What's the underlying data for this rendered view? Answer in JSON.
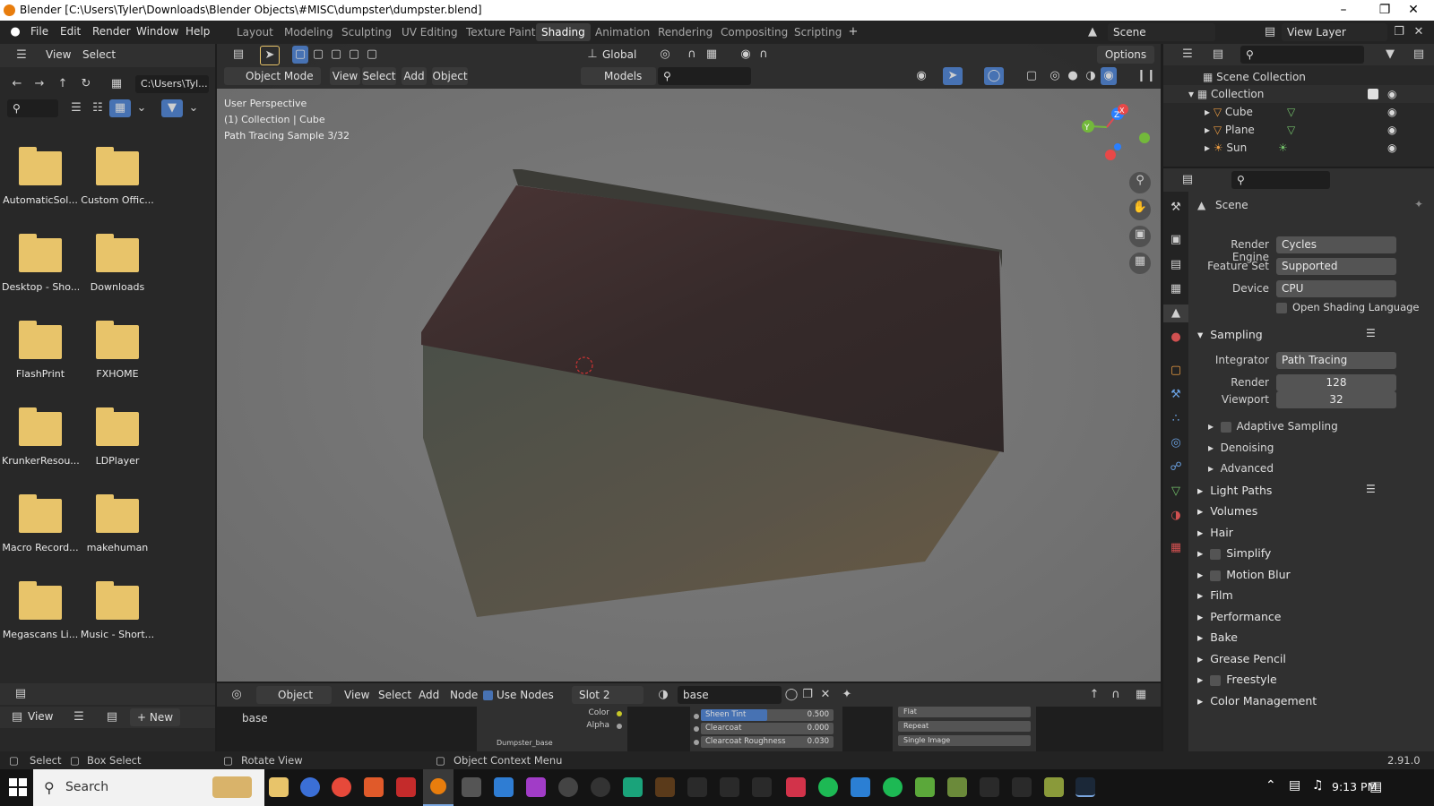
{
  "window": {
    "title": "Blender [C:\\Users\\Tyler\\Downloads\\Blender Objects\\#MISC\\dumpster\\dumpster.blend]"
  },
  "menu": [
    "File",
    "Edit",
    "Render",
    "Window",
    "Help"
  ],
  "workspaces": [
    "Layout",
    "Modeling",
    "Sculpting",
    "UV Editing",
    "Texture Paint",
    "Shading",
    "Animation",
    "Rendering",
    "Compositing",
    "Scripting"
  ],
  "active_workspace": "Shading",
  "scene_field": "Scene",
  "view_layer_field": "View Layer",
  "file_browser": {
    "menu": [
      "View",
      "Select"
    ],
    "path": "C:\\Users\\Tyl...",
    "folders": [
      "AutomaticSol...",
      "Custom Offic...",
      "Desktop - Sho...",
      "Downloads",
      "FlashPrint",
      "FXHOME",
      "KrunkerResou...",
      "LDPlayer",
      "Macro Record...",
      "makehuman",
      "Megascans Li...",
      "Music - Short..."
    ],
    "footer_view": "View",
    "footer_new": "New"
  },
  "viewport": {
    "orientation": "Global",
    "options_label": "Options",
    "mode": "Object Mode",
    "menus": [
      "View",
      "Select",
      "Add",
      "Object"
    ],
    "collection_filter": "Models",
    "overlay_lines": [
      "User Perspective",
      "(1) Collection | Cube",
      "Path Tracing Sample 3/32"
    ],
    "gizmo_axes": [
      "X",
      "Y",
      "Z"
    ]
  },
  "shader_editor": {
    "type": "Object",
    "menus": [
      "View",
      "Select",
      "Add",
      "Node"
    ],
    "use_nodes_label": "Use Nodes",
    "slot": "Slot 2",
    "material": "base",
    "node_label": "base",
    "sockets": [
      "Color",
      "Alpha"
    ],
    "params": [
      {
        "label": "Sheen Tint",
        "value": "0.500"
      },
      {
        "label": "Clearcoat",
        "value": "0.000"
      },
      {
        "label": "Clearcoat Roughness",
        "value": "0.030"
      }
    ],
    "image_node": [
      "Flat",
      "Repeat",
      "Single Image"
    ],
    "image_node_label": "Dumpster_base"
  },
  "outliner": {
    "root": "Scene Collection",
    "collection": "Collection",
    "items": [
      "Cube",
      "Plane",
      "Sun"
    ]
  },
  "properties": {
    "context": "Scene",
    "rows": [
      {
        "label": "Render Engine",
        "value": "Cycles"
      },
      {
        "label": "Feature Set",
        "value": "Supported"
      },
      {
        "label": "Device",
        "value": "CPU"
      }
    ],
    "osl_label": "Open Shading Language",
    "sampling_title": "Sampling",
    "integrator_label": "Integrator",
    "integrator_value": "Path Tracing",
    "render_label": "Render",
    "render_value": "128",
    "viewport_label": "Viewport",
    "viewport_value": "32",
    "sub_panels": [
      "Adaptive Sampling",
      "Denoising",
      "Advanced"
    ],
    "panels": [
      "Light Paths",
      "Volumes",
      "Hair",
      "Simplify",
      "Motion Blur",
      "Film",
      "Performance",
      "Bake",
      "Grease Pencil",
      "Freestyle",
      "Color Management"
    ]
  },
  "status_bar": {
    "select": "Select",
    "box_select": "Box Select",
    "rotate_view": "Rotate View",
    "context_menu": "Object Context Menu",
    "version": "2.91.0"
  },
  "taskbar": {
    "search_placeholder": "Search",
    "time": "9:13 PM"
  }
}
